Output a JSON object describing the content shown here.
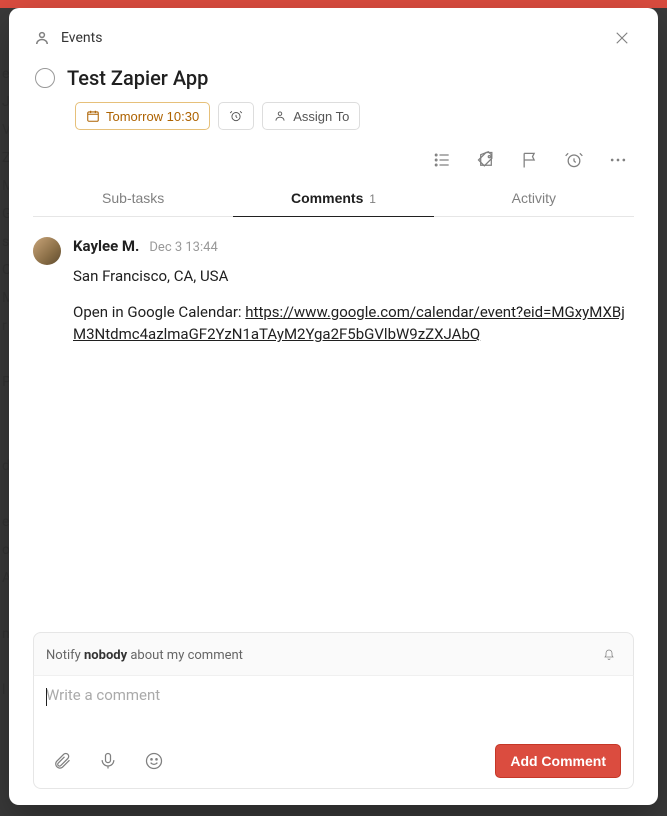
{
  "header": {
    "project": "Events"
  },
  "task": {
    "title": "Test Zapier App",
    "due_label": "Tomorrow 10:30",
    "assign_label": "Assign To"
  },
  "tabs": {
    "subtasks": "Sub-tasks",
    "comments": "Comments",
    "comments_count": "1",
    "activity": "Activity"
  },
  "comment": {
    "author": "Kaylee M.",
    "timestamp": "Dec 3 13:44",
    "line1": "San Francisco, CA, USA",
    "line2_prefix": "Open in Google Calendar: ",
    "link_text": "https://www.google.com/calendar/event?eid=MGxyMXBjM3Ntdmc4azlmaGF2YzN1aTAyM2Yga2F5bGVlbW9zZXJAbQ"
  },
  "footer": {
    "notify_prefix": "Notify ",
    "notify_bold": "nobody",
    "notify_suffix": " about my comment",
    "placeholder": "Write a comment",
    "add_button": "Add Comment"
  }
}
